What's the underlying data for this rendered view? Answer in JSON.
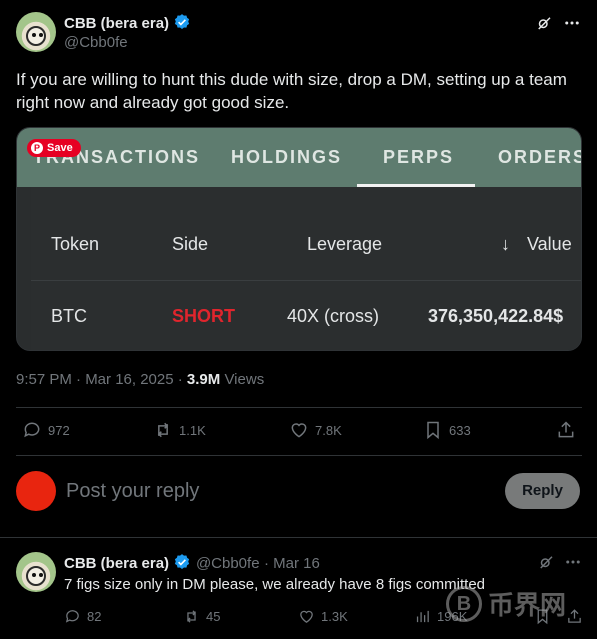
{
  "tweet": {
    "author_name": "CBB (bera era)",
    "author_handle": "@Cbb0fe",
    "text": "If you are willing to hunt this dude with size, drop a DM, setting up a team right now and already got good size.",
    "timestamp": "9:57 PM · Mar 16, 2025 · ",
    "views_count": "3.9M",
    "views_label": " Views",
    "stats": {
      "replies": "972",
      "reposts": "1.1K",
      "likes": "7.8K",
      "bookmarks": "633"
    }
  },
  "embedded_card": {
    "save_label": "Save",
    "tabs": [
      "TRANSACTIONS",
      "HOLDINGS",
      "PERPS",
      "ORDERS"
    ],
    "active_tab": "PERPS",
    "tab_bar_color": "#5e7c6f",
    "columns": [
      "Token",
      "Side",
      "Leverage",
      "Value"
    ],
    "sort_arrow": "↓",
    "rows": [
      {
        "token": "BTC",
        "side": "SHORT",
        "leverage": "40X (cross)",
        "value": "376,350,422.84$"
      }
    ],
    "short_color": "#e0252d"
  },
  "compose": {
    "placeholder": "Post your reply",
    "reply_label": "Reply"
  },
  "reply_tweet": {
    "author_name": "CBB (bera era)",
    "author_handle": "@Cbb0fe",
    "date": "· Mar 16",
    "text": "7 figs size only in DM please, we already have 8 figs committed",
    "stats": {
      "replies": "82",
      "reposts": "45",
      "likes": "1.3K",
      "views": "196K"
    }
  },
  "watermark": "币界网",
  "colors": {
    "verified": "#1d9bf0",
    "background": "#000000",
    "muted": "#71767b"
  }
}
